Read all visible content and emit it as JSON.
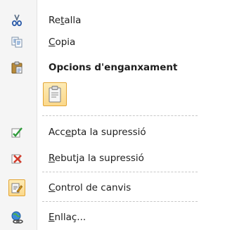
{
  "menu": {
    "items": [
      {
        "pre": "Re",
        "mnemonic": "t",
        "post": "alla",
        "icon": "scissors-icon"
      },
      {
        "pre": "",
        "mnemonic": "C",
        "post": "opia",
        "icon": "copy-icon"
      },
      {
        "header": "Opcions d'enganxament",
        "icon": "clipboard-icon"
      },
      {
        "pre": "Acc",
        "mnemonic": "e",
        "post": "pta la supressió",
        "icon": "accept-deletion-icon"
      },
      {
        "pre": "",
        "mnemonic": "R",
        "post": "ebutja la supressió",
        "icon": "reject-deletion-icon"
      },
      {
        "pre": "",
        "mnemonic": "C",
        "post": "ontrol de canvis",
        "icon": "track-changes-icon"
      },
      {
        "pre": "",
        "mnemonic": "E",
        "post": "nllaç...",
        "icon": "hyperlink-icon"
      }
    ]
  }
}
